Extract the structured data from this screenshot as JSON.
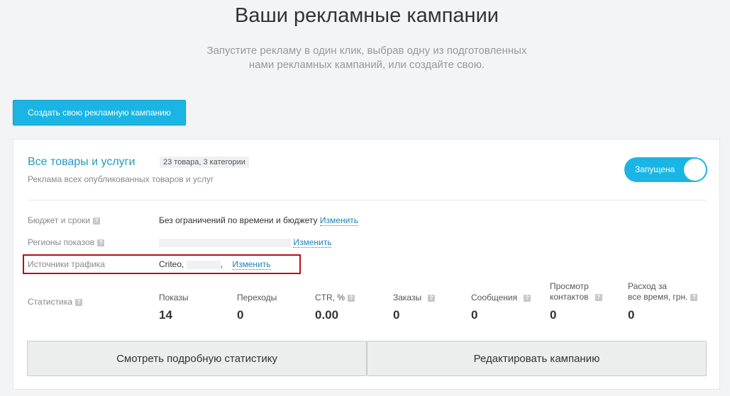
{
  "header": {
    "title": "Ваши рекламные кампании",
    "subtitle_line1": "Запустите рекламу в один клик, выбрав одну из подготовленных",
    "subtitle_line2": "нами рекламных кампаний, или создайте свою."
  },
  "create_button": "Создать свою рекламную кампанию",
  "campaign": {
    "title": "Все товары и услуги",
    "badge": "23 товара, 3 категории",
    "description": "Реклама всех опубликованных товаров и услуг",
    "status_toggle": {
      "label": "Запущена",
      "on": true
    },
    "rows": {
      "budget": {
        "label": "Бюджет и сроки",
        "value": "Без ограничений по времени и бюджету",
        "link": "Изменить"
      },
      "regions": {
        "label": "Регионы показов",
        "link": "Изменить"
      },
      "traffic": {
        "label": "Источники трафика",
        "value": "Criteo,",
        "sep": ",",
        "link": "Изменить"
      }
    },
    "stats": {
      "label": "Статистика",
      "items": [
        {
          "label": "Показы",
          "value": "14"
        },
        {
          "label": "Переходы",
          "value": "0"
        },
        {
          "label": "CTR, %",
          "value": "0.00"
        },
        {
          "label": "Заказы",
          "value": "0"
        },
        {
          "label": "Сообщения",
          "value": "0"
        },
        {
          "label_line1": "Просмотр",
          "label_line2": "контактов",
          "value": "0"
        },
        {
          "label_line1": "Расход за",
          "label_line2": "все время, грн.",
          "value": "0"
        }
      ]
    },
    "buttons": {
      "stats": "Смотреть подробную статистику",
      "edit": "Редактировать кампанию"
    }
  },
  "colors": {
    "accent": "#1ab5e4",
    "link": "#1e83b8",
    "highlight": "#b5101a"
  }
}
